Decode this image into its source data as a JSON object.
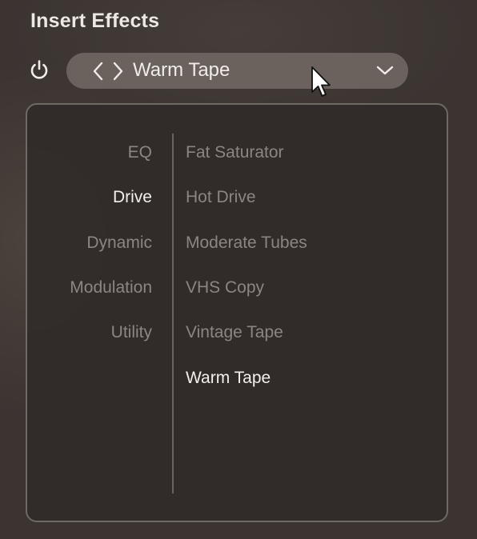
{
  "header": {
    "title": "Insert Effects"
  },
  "power_icon": "power-icon",
  "selector": {
    "prev_icon": "chevron-left-icon",
    "next_icon": "chevron-right-icon",
    "value": "Warm Tape",
    "dropdown_icon": "chevron-down-icon"
  },
  "dropdown": {
    "categories": [
      "EQ",
      "Drive",
      "Dynamic",
      "Modulation",
      "Utility"
    ],
    "selected_category": "Drive",
    "presets": [
      "Fat Saturator",
      "Hot Drive",
      "Moderate Tubes",
      "VHS Copy",
      "Vintage Tape",
      "Warm Tape"
    ],
    "selected_preset": "Warm Tape"
  },
  "colors": {
    "background": "#3b3431",
    "selector_bg": "#6b625d",
    "panel_border": "#6f6863",
    "text_active": "#f3f0ec",
    "text_inactive": "#8d8580"
  }
}
